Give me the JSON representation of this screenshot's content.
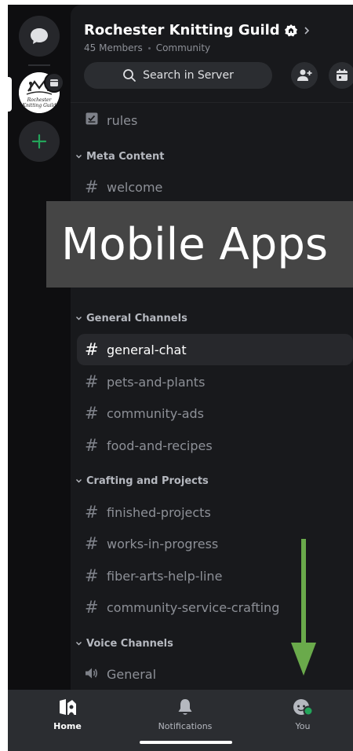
{
  "server": {
    "name": "Rochester Knitting Guild",
    "members": "45 Members",
    "type": "Community",
    "icon_caption": "Rochester Knitting Guild"
  },
  "search": {
    "label": "Search in Server"
  },
  "rules_channel": {
    "name": "rules"
  },
  "categories": [
    {
      "name": "Meta Content",
      "channels": [
        "welcome"
      ]
    },
    {
      "name": "General Channels",
      "channels": [
        "general-chat",
        "pets-and-plants",
        "community-ads",
        "food-and-recipes"
      ]
    },
    {
      "name": "Crafting and Projects",
      "channels": [
        "finished-projects",
        "works-in-progress",
        "fiber-arts-help-line",
        "community-service-crafting"
      ]
    },
    {
      "name": "Voice Channels",
      "channels": [
        "General"
      ]
    }
  ],
  "selected_channel": "general-chat",
  "overlay": {
    "text": "Mobile Apps"
  },
  "tabs": [
    {
      "label": "Home"
    },
    {
      "label": "Notifications"
    },
    {
      "label": "You"
    }
  ],
  "colors": {
    "accent_add": "#23a55a",
    "arrow": "#6aaa4b",
    "status_online": "#23a55a"
  },
  "icons": [
    "dm-bubble-icon",
    "add-server-icon",
    "verified-badge-icon",
    "chevron-right-icon",
    "search-icon",
    "add-member-icon",
    "calendar-icon",
    "rules-icon",
    "hash-icon",
    "speaker-icon",
    "home-icon",
    "bell-icon",
    "avatar-icon"
  ]
}
